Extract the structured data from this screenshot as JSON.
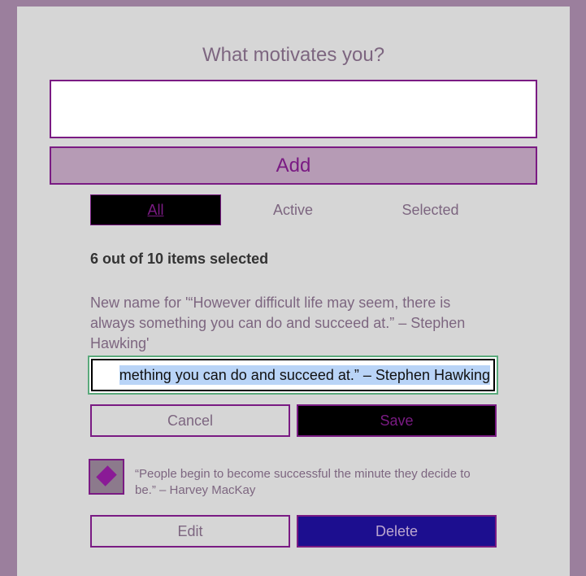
{
  "form": {
    "title": "What motivates you?",
    "input_value": "",
    "add_label": "Add"
  },
  "filters": {
    "all": "All",
    "active": "Active",
    "selected": "Selected",
    "current": "All"
  },
  "status": {
    "count_text": "6 out of 10 items selected"
  },
  "editing_item": {
    "rename_label": "New name for '“However difficult life may seem, there is always something you can do and succeed at.” – Stephen Hawking'",
    "input_visible_value": "mething you can do and succeed at.” – Stephen Hawking",
    "cancel_label": "Cancel",
    "save_label": "Save"
  },
  "next_item": {
    "text": "“People begin to become successful the minute they decide to be.” – Harvey MacKay",
    "checked": true,
    "check_icon": "check-icon",
    "edit_label": "Edit",
    "delete_label": "Delete"
  },
  "colors": {
    "page_bg": "#9b7f9d",
    "card_bg": "#d6d6d6",
    "accent": "#7a1b83",
    "add_button_bg": "#b69bb5",
    "delete_button_bg": "#1c0e8f",
    "focus_ring": "#5aa97b"
  }
}
